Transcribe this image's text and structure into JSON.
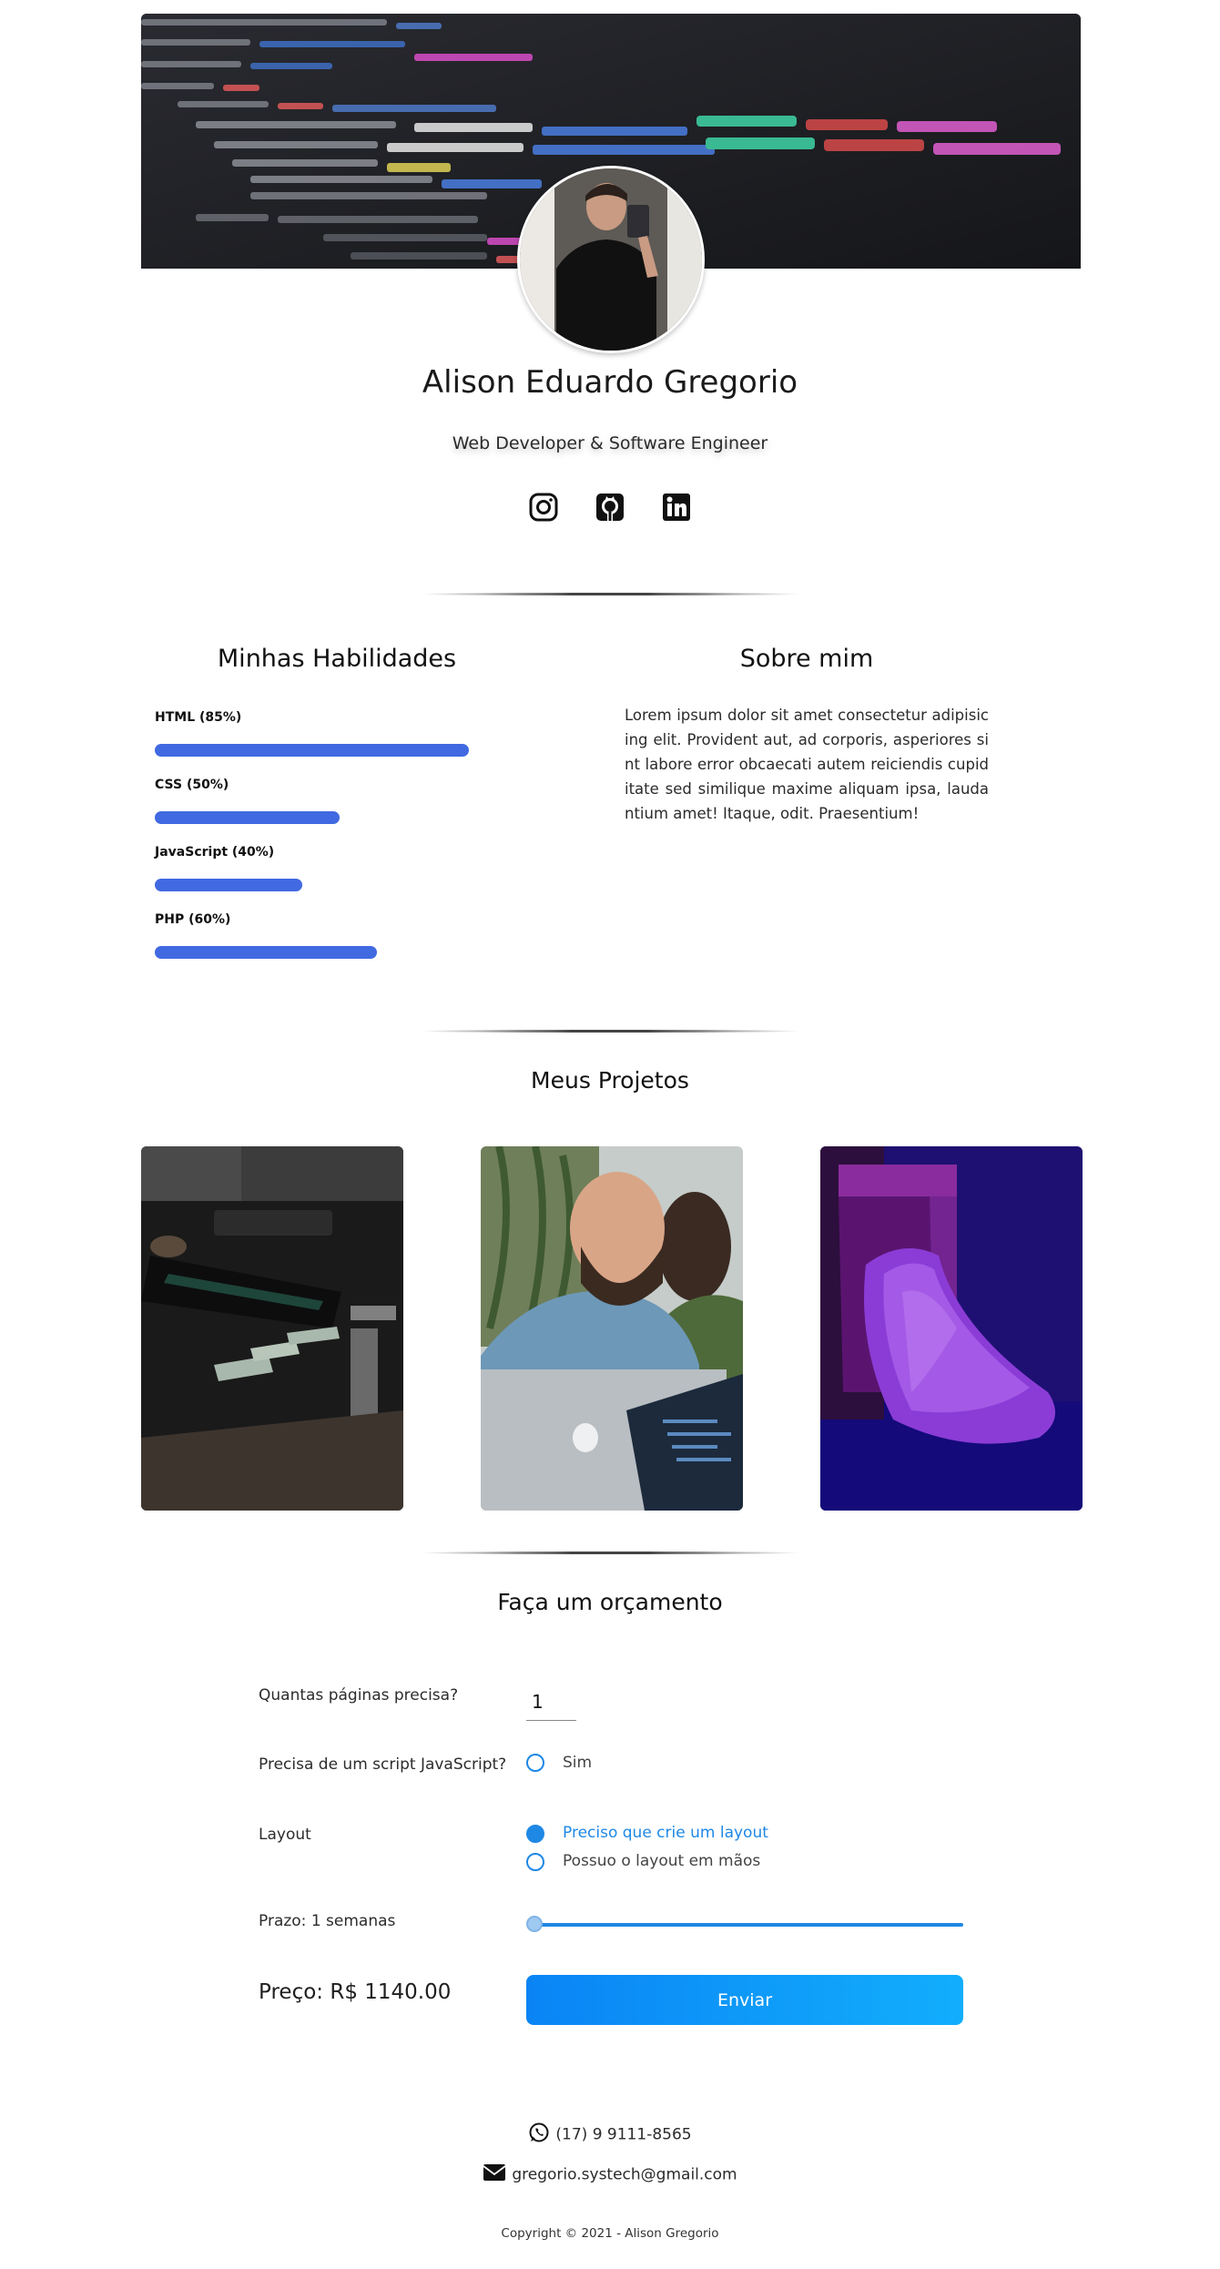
{
  "profile": {
    "name": "Alison Eduardo Gregorio",
    "role": "Web Developer & Software Engineer",
    "socials": [
      "instagram-icon",
      "github-icon",
      "linkedin-icon"
    ]
  },
  "skills": {
    "title": "Minhas Habilidades",
    "items": [
      {
        "label": "HTML (85%)",
        "percent": 85
      },
      {
        "label": "CSS (50%)",
        "percent": 50
      },
      {
        "label": "JavaScript (40%)",
        "percent": 40
      },
      {
        "label": "PHP (60%)",
        "percent": 60
      }
    ],
    "bar_color": "#4169e1"
  },
  "about": {
    "title": "Sobre mim",
    "text": "Lorem ipsum dolor sit amet consectetur adipisicing elit. Provident aut, ad corporis, asperiores sint labore error obcaecati autem reiciendis cupiditate sed similique maxime aliquam ipsa, laudantium amet! Itaque, odit. Praesentium!"
  },
  "projects": {
    "title": "Meus Projetos"
  },
  "quote": {
    "title": "Faça um orçamento",
    "pages_label": "Quantas páginas precisa?",
    "pages_value": "1",
    "js_label": "Precisa de um script JavaScript?",
    "js_option": "Sim",
    "layout_label": "Layout",
    "layout_option_1": "Preciso que crie um layout",
    "layout_option_2": "Possuo o layout em mãos",
    "deadline_label": "Prazo: 1 semanas",
    "price": "Preço: R$ 1140.00",
    "submit": "Enviar",
    "accent": "#1e88e5"
  },
  "contact": {
    "phone": "(17) 9 9111-8565",
    "email": "gregorio.systech@gmail.com"
  },
  "footer": {
    "copyright": "Copyright © 2021 - Alison Gregorio"
  }
}
